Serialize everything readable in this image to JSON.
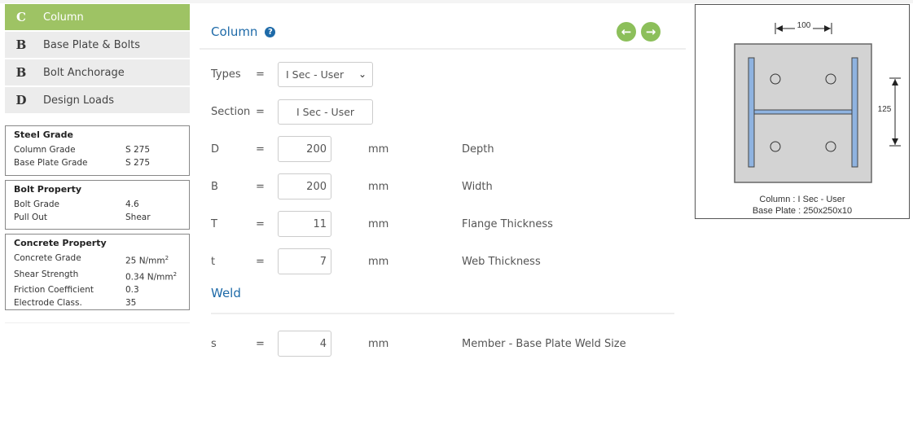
{
  "nav": {
    "items": [
      {
        "letter": "C",
        "label": "Column",
        "active": true
      },
      {
        "letter": "B",
        "label": "Base Plate & Bolts",
        "active": false
      },
      {
        "letter": "B",
        "label": "Bolt Anchorage",
        "active": false
      },
      {
        "letter": "D",
        "label": "Design Loads",
        "active": false
      }
    ]
  },
  "steel_grade": {
    "title": "Steel Grade",
    "rows": [
      {
        "key": "Column Grade",
        "value": "S 275"
      },
      {
        "key": "Base Plate Grade",
        "value": "S 275"
      }
    ]
  },
  "bolt_property": {
    "title": "Bolt Property",
    "rows": [
      {
        "key": "Bolt Grade",
        "value": "4.6"
      },
      {
        "key": "Pull Out",
        "value": "Shear"
      }
    ]
  },
  "concrete_property": {
    "title": "Concrete Property",
    "rows": [
      {
        "key": "Concrete Grade",
        "value": "25 N/mm",
        "sup": "2"
      },
      {
        "key": "Shear Strength",
        "value": "0.34 N/mm",
        "sup": "2"
      },
      {
        "key": "Friction Coefficient",
        "value": "0.3"
      },
      {
        "key": "Electrode Class.",
        "value": "35"
      }
    ]
  },
  "main": {
    "title": "Column",
    "help_icon": "?",
    "prev_icon": "arrow-left-circle",
    "next_icon": "arrow-right-circle",
    "prev_glyph": "←",
    "next_glyph": "→",
    "types": {
      "label": "Types",
      "eq": "=",
      "value": "I Sec - User",
      "chevron": "⌄"
    },
    "section": {
      "label": "Section",
      "eq": "=",
      "value": "I Sec - User"
    },
    "fields": [
      {
        "symbol": "D",
        "eq": "=",
        "value": "200",
        "unit": "mm",
        "desc": "Depth"
      },
      {
        "symbol": "B",
        "eq": "=",
        "value": "200",
        "unit": "mm",
        "desc": "Width"
      },
      {
        "symbol": "T",
        "eq": "=",
        "value": "11",
        "unit": "mm",
        "desc": "Flange Thickness"
      },
      {
        "symbol": "t",
        "eq": "=",
        "value": "7",
        "unit": "mm",
        "desc": "Web Thickness"
      }
    ],
    "weld": {
      "title": "Weld",
      "field": {
        "symbol": "s",
        "eq": "=",
        "value": "4",
        "unit": "mm",
        "desc": "Member - Base Plate Weld Size"
      }
    }
  },
  "diagram": {
    "dim_horizontal": "100",
    "dim_vertical": "125",
    "caption_column": "Column : I Sec - User",
    "caption_plate": "Base Plate : 250x250x10",
    "colors": {
      "plate": "#d3d3d3",
      "section": "#8fb3e0",
      "outline": "#555555"
    }
  }
}
